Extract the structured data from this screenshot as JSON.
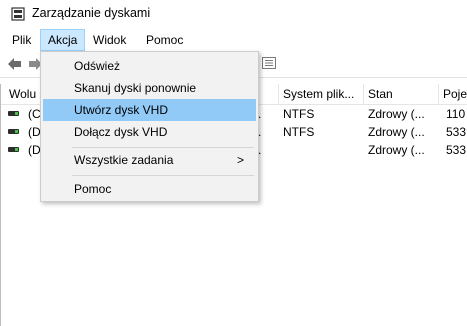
{
  "window": {
    "title": "Zarządzanie dyskami"
  },
  "menubar": {
    "items": [
      "Plik",
      "Akcja",
      "Widok",
      "Pomoc"
    ]
  },
  "dropdown": {
    "items": [
      {
        "label": "Odśwież"
      },
      {
        "label": "Skanuj dyski ponownie"
      },
      {
        "label": "Utwórz dysk VHD"
      },
      {
        "label": "Dołącz dysk VHD"
      },
      {
        "label": "Wszystkie zadania",
        "submenu_arrow": ">"
      },
      {
        "label": "Pomoc"
      }
    ]
  },
  "table": {
    "headers": [
      "Wolu",
      "System plik...",
      "Stan",
      "Poje"
    ],
    "rows": [
      {
        "volume": "(C",
        "dot": ".",
        "fs": "NTFS",
        "status": "Zdrowy (...",
        "capacity": "110"
      },
      {
        "volume": "(Dy",
        "dot": ".",
        "fs": "NTFS",
        "status": "Zdrowy (...",
        "capacity": "533"
      },
      {
        "volume": "(Dy",
        "dot": ".",
        "fs": "",
        "status": "Zdrowy (...",
        "capacity": "533"
      }
    ]
  },
  "colors": {
    "highlight": "#91c9f7",
    "menu_active": "#cce8ff",
    "menu_bg": "#f2f2f2"
  }
}
